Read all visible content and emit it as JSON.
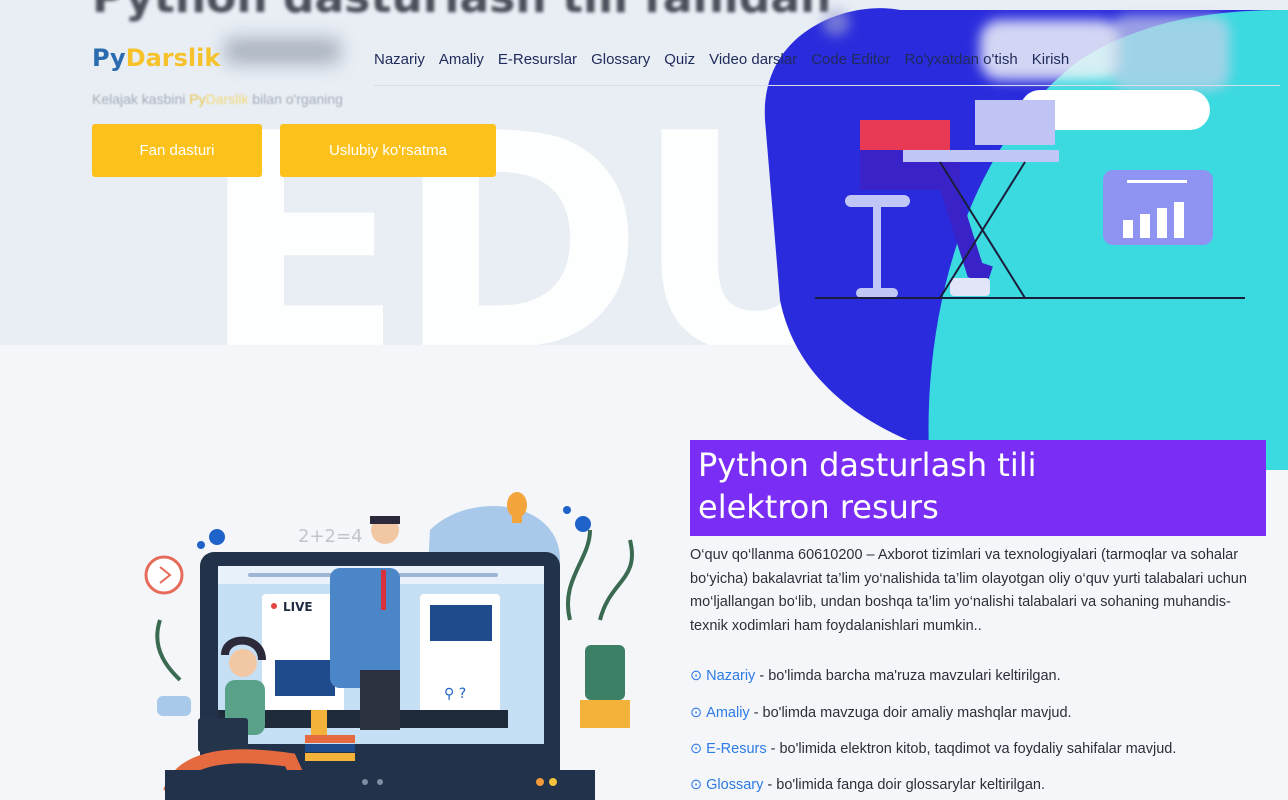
{
  "hero": {
    "big_bg_text": "EDU",
    "title": "Python dasturlash tili fanidan",
    "subtitle_pre": "Kelajak kasbini",
    "subtitle_py": "Py",
    "subtitle_post": "bilan o'rganing",
    "buttons": [
      "Fan dasturi",
      "Uslubiy ko'rsatma"
    ]
  },
  "logo": {
    "part1": "Py",
    "part2": "Darslik"
  },
  "nav": [
    "Nazariy",
    "Amaliy",
    "E-Resurslar",
    "Glossary",
    "Quiz",
    "Video darslar",
    "Code Editor",
    "Ro'yxatdan o'tish",
    "Kirish"
  ],
  "illustration": {
    "live": "LIVE",
    "math": "2+2=4"
  },
  "section": {
    "title_line1": "Python dasturlash tili",
    "title_line2": "elektron resurs",
    "description": "O‘quv qo‘llanma 60610200 – Axborot tizimlari va texnologiyalari (tarmoqlar va sohalar bo‘yicha) bakalavriat ta’lim yo‘nalishida ta’lim olayotgan oliy o‘quv yurti talabalari uchun mo‘ljallangan bo‘lib, undan boshqa ta’lim yo‘nalishi talabalari va sohaning muhandis-texnik xodimlari ham foydalanishlari mumkin..",
    "features": [
      {
        "link": "Nazariy",
        "text": " - bo'limda barcha ma'ruza mavzulari keltirilgan."
      },
      {
        "link": "Amaliy",
        "text": " - bo'limda mavzuga doir amaliy mashqlar mavjud."
      },
      {
        "link": "E-Resurs",
        "text": " - bo'limida elektron kitob, taqdimot va foydaliy sahifalar mavjud."
      },
      {
        "link": "Glossary",
        "text": " - bo'limida fanga doir glossarylar keltirilgan."
      }
    ]
  },
  "colors": {
    "accent_yellow": "#fcc21b",
    "brand_blue": "#2b6cb0",
    "purple": "#7a2df5",
    "cyan": "#3bd9e0",
    "royal_blue": "#2a2bdc",
    "link": "#2d7be5"
  },
  "icons": [
    "check-circle-icon",
    "play-icon",
    "lightbulb-icon",
    "question-icon",
    "location-icon",
    "chart-icon"
  ]
}
